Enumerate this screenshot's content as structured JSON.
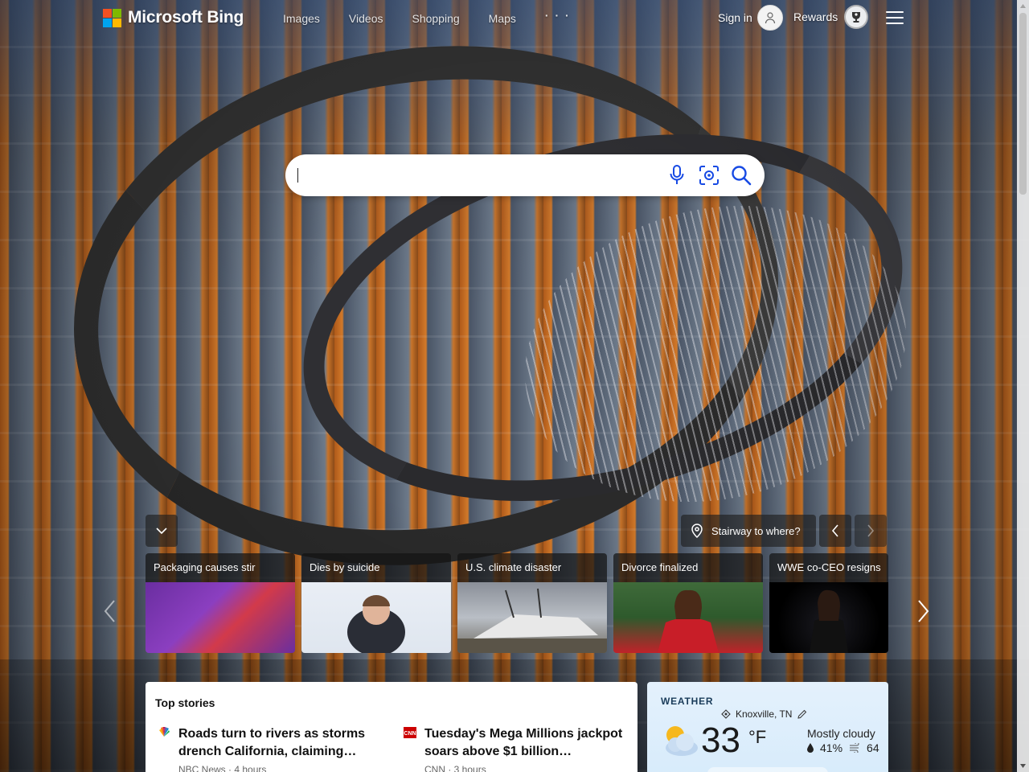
{
  "header": {
    "logo_text": "Microsoft Bing",
    "logo_colors": [
      "#f25022",
      "#7fba00",
      "#00a4ef",
      "#ffb900"
    ],
    "nav": [
      {
        "label": "Images"
      },
      {
        "label": "Videos"
      },
      {
        "label": "Shopping"
      },
      {
        "label": "Maps"
      },
      {
        "label": "· · ·"
      }
    ],
    "sign_in_label": "Sign in",
    "rewards_label": "Rewards"
  },
  "search": {
    "value": "",
    "placeholder": "",
    "icons": [
      "microphone-icon",
      "visual-search-icon",
      "search-icon"
    ]
  },
  "image_info": {
    "title": "Stairway to where?",
    "icon": "location-pin-icon"
  },
  "news_carousel": {
    "items": [
      {
        "caption": "Packaging causes stir"
      },
      {
        "caption": "Dies by suicide"
      },
      {
        "caption": "U.S. climate disaster"
      },
      {
        "caption": "Divorce finalized"
      },
      {
        "caption": "WWE co-CEO resigns"
      }
    ]
  },
  "top_stories": {
    "title": "Top stories",
    "stories": [
      {
        "source_icon": "nbc-peacock-icon",
        "headline": "Roads turn to rivers as storms drench California, claiming…",
        "meta": "NBC News · 4 hours"
      },
      {
        "source_icon": "cnn-icon",
        "headline": "Tuesday's Mega Millions jackpot soars above $1 billion…",
        "meta": "CNN · 3 hours"
      }
    ]
  },
  "weather": {
    "title": "WEATHER",
    "location": "Knoxville, TN",
    "temperature": "33",
    "unit": "°F",
    "condition": "Mostly cloudy",
    "precipitation": "41%",
    "air_quality": "64"
  },
  "colors": {
    "accent": "#174ae4",
    "weather_bg": "#e4f1fc"
  }
}
